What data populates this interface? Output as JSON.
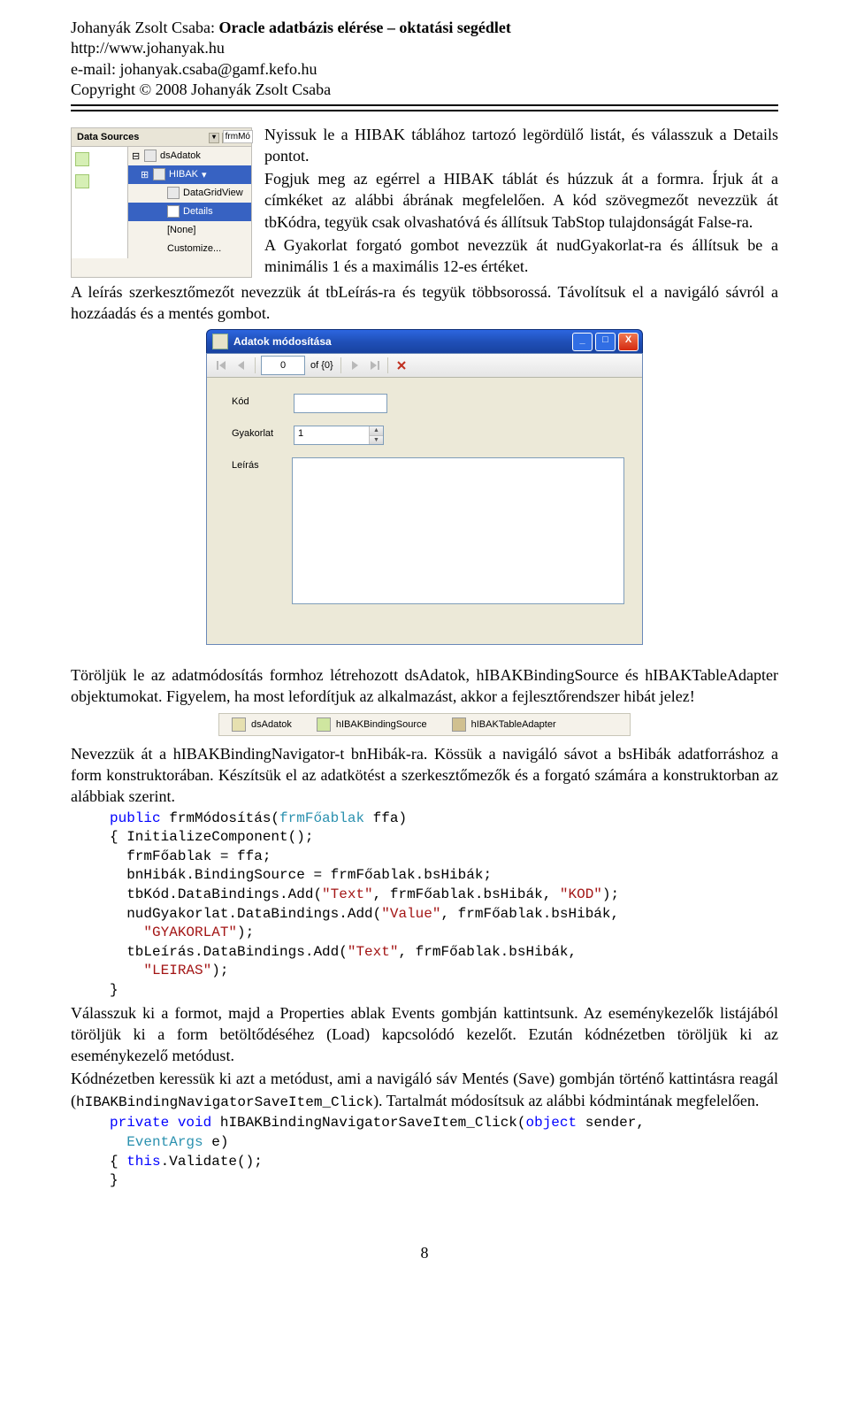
{
  "header": {
    "author": "Johanyák Zsolt Csaba:",
    "title": "Oracle adatbázis elérése – oktatási segédlet",
    "url": "http://www.johanyak.hu",
    "email": "e-mail: johanyak.csaba@gamf.kefo.hu",
    "copyright": "Copyright © 2008 Johanyák Zsolt Csaba"
  },
  "ds": {
    "title": "Data Sources",
    "frm": "frmMó",
    "adat": "dsAdatok",
    "node": "HIBAK",
    "items": [
      "DataGridView",
      "Details",
      "[None]",
      "Customize..."
    ],
    "selected": "HIBAK"
  },
  "para": {
    "p1a": "Nyissuk le a HIBAK táblához tartozó legördülő listát, és válasszuk a Details pontot.",
    "p1b": "Fogjuk meg az egérrel a HIBAK táblát és húzzuk át a formra. Írjuk át a címkéket az alábbi ábrának megfelelően. A kód szövegmezőt nevezzük át tbKódra, tegyük csak olvashatóvá és állítsuk TabStop tulajdonságát False-ra.",
    "p1c": "A Gyakorlat forgató gombot nevezzük át nudGyakorlat-ra és állítsuk be a minimális 1 és a maximális 12-es értéket.",
    "p1d": "A leírás szerkesztőmezőt nevezzük át tbLeírás-ra és tegyük többsorossá. Távolítsuk el a navigáló sávról a hozzáadás és a mentés gombot.",
    "p2": "Töröljük le az adatmódosítás formhoz létrehozott dsAdatok, hIBAKBindingSource és hIBAKTableAdapter objektumokat. Figyelem, ha most lefordítjuk az alkalmazást, akkor a fejlesztőrendszer hibát jelez!",
    "p3": "Nevezzük át a hIBAKBindingNavigator-t bnHibák-ra. Kössük a navigáló sávot a bsHibák adatforráshoz a form konstruktorában. Készítsük el az adatkötést a szerkesztőmezők és a forgató számára a konstruktorban az alábbiak szerint.",
    "p4": "Válasszuk ki a formot, majd a Properties ablak Events gombján kattintsunk. Az eseménykezelők listájából töröljük ki a form betöltődéséhez (Load) kapcsolódó kezelőt. Ezután kódnézetben töröljük ki az eseménykezelő metódust.",
    "p5a": "Kódnézetben keressük ki azt a metódust, ami a navigáló sáv Mentés (Save) gombján történő kattintásra reagál (",
    "p5mono": "hIBAKBindingNavigatorSaveItem_Click",
    "p5b": "). Tartalmát módosítsuk az alábbi kódmintának megfelelően."
  },
  "win": {
    "title": "Adatok módosítása",
    "pos": "0",
    "count": "of {0}",
    "lbl_kod": "Kód",
    "lbl_gyak": "Gyakorlat",
    "lbl_leiras": "Leírás",
    "gyak_val": "1"
  },
  "components": {
    "c1": "dsAdatok",
    "c2": "hIBAKBindingSource",
    "c3": "hIBAKTableAdapter"
  },
  "code1": {
    "l1_kw1": "public",
    "l1_rest": " frmMódosítás(",
    "l1_tp": "frmFőablak",
    "l1_rest2": " ffa)",
    "l2": "{ InitializeComponent();",
    "l3": "  frmFőablak = ffa;",
    "l4": "  bnHibák.BindingSource = frmFőablak.bsHibák;",
    "l5a": "  tbKód.DataBindings.Add(",
    "l5s1": "\"Text\"",
    "l5b": ", frmFőablak.bsHibák, ",
    "l5s2": "\"KOD\"",
    "l5c": ");",
    "l6a": "  nudGyakorlat.DataBindings.Add(",
    "l6s1": "\"Value\"",
    "l6b": ", frmFőablak.bsHibák,",
    "l7a": "    ",
    "l7s": "\"GYAKORLAT\"",
    "l7b": ");",
    "l8a": "  tbLeírás.DataBindings.Add(",
    "l8s1": "\"Text\"",
    "l8b": ", frmFőablak.bsHibák,",
    "l9a": "    ",
    "l9s": "\"LEIRAS\"",
    "l9b": ");",
    "l10": "}"
  },
  "code2": {
    "l1_kw1": "private",
    "l1_kw2": "void",
    "l1_rest": " hIBAKBindingNavigatorSaveItem_Click(",
    "l1_kw3": "object",
    "l1_rest2": " sender,",
    "l2a": "  ",
    "l2_tp": "EventArgs",
    "l2b": " e)",
    "l3a": "{ ",
    "l3_kw": "this",
    "l3b": ".Validate();",
    "l4": "}"
  },
  "page_number": "8"
}
